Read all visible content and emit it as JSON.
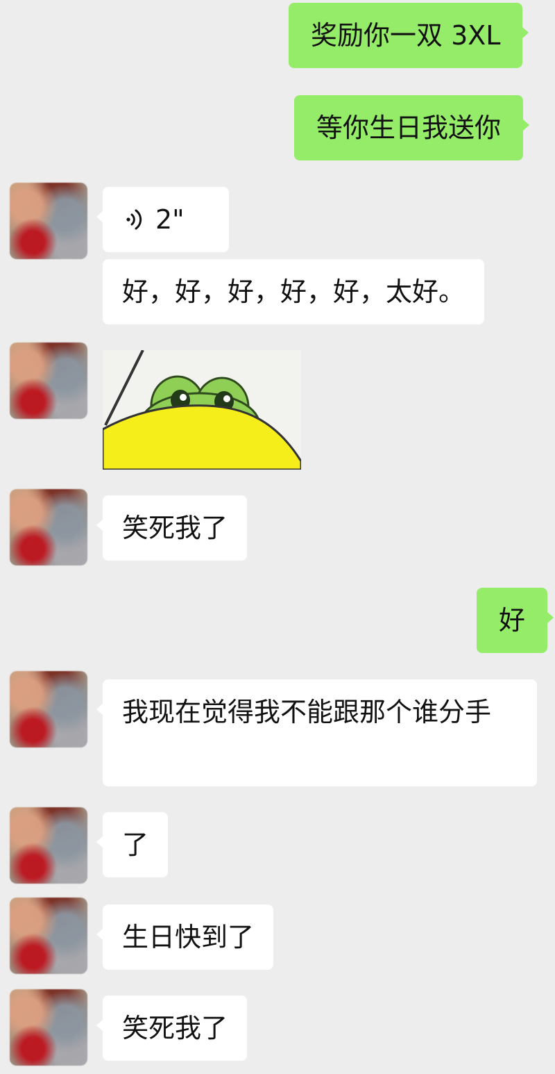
{
  "chat": {
    "messages": [
      {
        "id": "m1",
        "sender": "me",
        "type": "text",
        "text": "奖励你一双 3XL"
      },
      {
        "id": "m2",
        "sender": "me",
        "type": "text",
        "text": "等你生日我送你"
      },
      {
        "id": "m3",
        "sender": "contact",
        "type": "voice",
        "duration": "2\""
      },
      {
        "id": "m4",
        "sender": "contact",
        "type": "text",
        "text": "好，好，好，好，好，太好。"
      },
      {
        "id": "m5",
        "sender": "contact",
        "type": "sticker",
        "sticker": "frog-peeking-sticker"
      },
      {
        "id": "m6",
        "sender": "contact",
        "type": "text",
        "text": "笑死我了"
      },
      {
        "id": "m7",
        "sender": "me",
        "type": "text",
        "text": "好"
      },
      {
        "id": "m8",
        "sender": "contact",
        "type": "text",
        "text": "我现在觉得我不能跟那个谁分手"
      },
      {
        "id": "m9",
        "sender": "contact",
        "type": "text",
        "text": "了"
      },
      {
        "id": "m10",
        "sender": "contact",
        "type": "text",
        "text": "生日快到了"
      },
      {
        "id": "m11",
        "sender": "contact",
        "type": "text",
        "text": "笑死我了"
      }
    ]
  },
  "colors": {
    "background": "#ededed",
    "my_bubble": "#95ec69",
    "contact_bubble": "#ffffff"
  },
  "icons": {
    "voice": "voice-wave-icon",
    "avatar": "blurred-avatar"
  }
}
